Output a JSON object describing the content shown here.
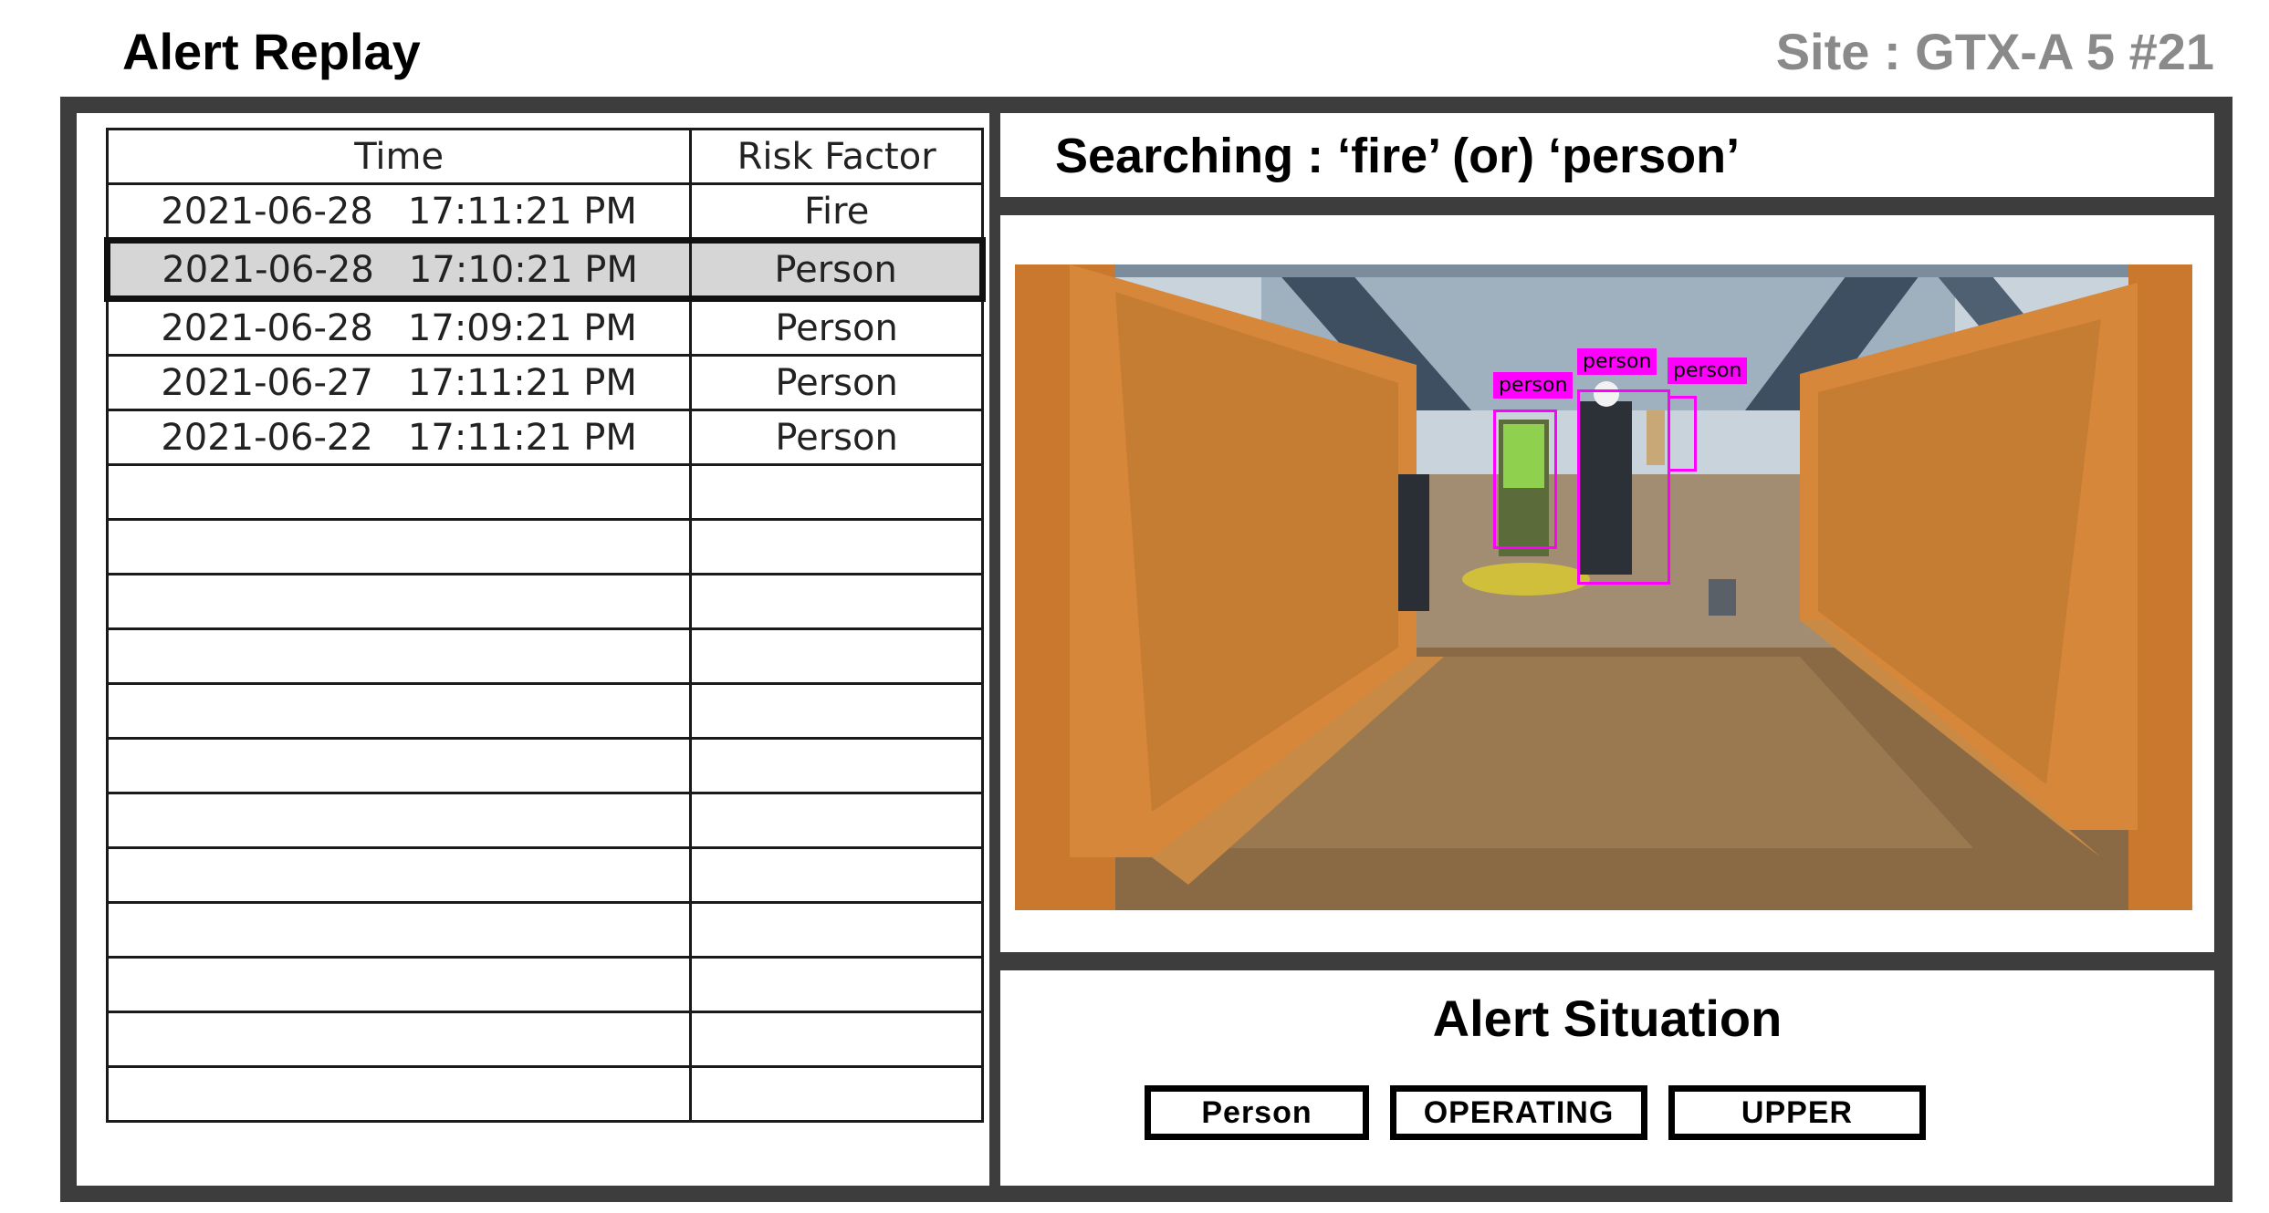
{
  "header": {
    "title": "Alert Replay",
    "site": "Site : GTX-A 5 #21"
  },
  "table": {
    "headers": {
      "time": "Time",
      "risk": "Risk Factor"
    },
    "rows": [
      {
        "time": "2021-06-28   17:11:21 PM",
        "risk": "Fire",
        "selected": false
      },
      {
        "time": "2021-06-28   17:10:21 PM",
        "risk": "Person",
        "selected": true
      },
      {
        "time": "2021-06-28   17:09:21 PM",
        "risk": "Person",
        "selected": false
      },
      {
        "time": "2021-06-27   17:11:21 PM",
        "risk": "Person",
        "selected": false
      },
      {
        "time": "2021-06-22   17:11:21 PM",
        "risk": "Person",
        "selected": false
      },
      {
        "time": "",
        "risk": ""
      },
      {
        "time": "",
        "risk": ""
      },
      {
        "time": "",
        "risk": ""
      },
      {
        "time": "",
        "risk": ""
      },
      {
        "time": "",
        "risk": ""
      },
      {
        "time": "",
        "risk": ""
      },
      {
        "time": "",
        "risk": ""
      },
      {
        "time": "",
        "risk": ""
      },
      {
        "time": "",
        "risk": ""
      },
      {
        "time": "",
        "risk": ""
      },
      {
        "time": "",
        "risk": ""
      },
      {
        "time": "",
        "risk": ""
      }
    ]
  },
  "search": {
    "text": "Searching : ‘fire’ (or) ‘person’"
  },
  "detection": {
    "labels": [
      "person",
      "person",
      "person"
    ],
    "box_color": "#ff00ff"
  },
  "situation": {
    "title": "Alert Situation",
    "chips": [
      "Person",
      "OPERATING",
      "UPPER"
    ]
  },
  "colors": {
    "frame": "#3d3d3d",
    "site_label": "#8a8a8a",
    "selected_row": "#d6d6d6"
  }
}
